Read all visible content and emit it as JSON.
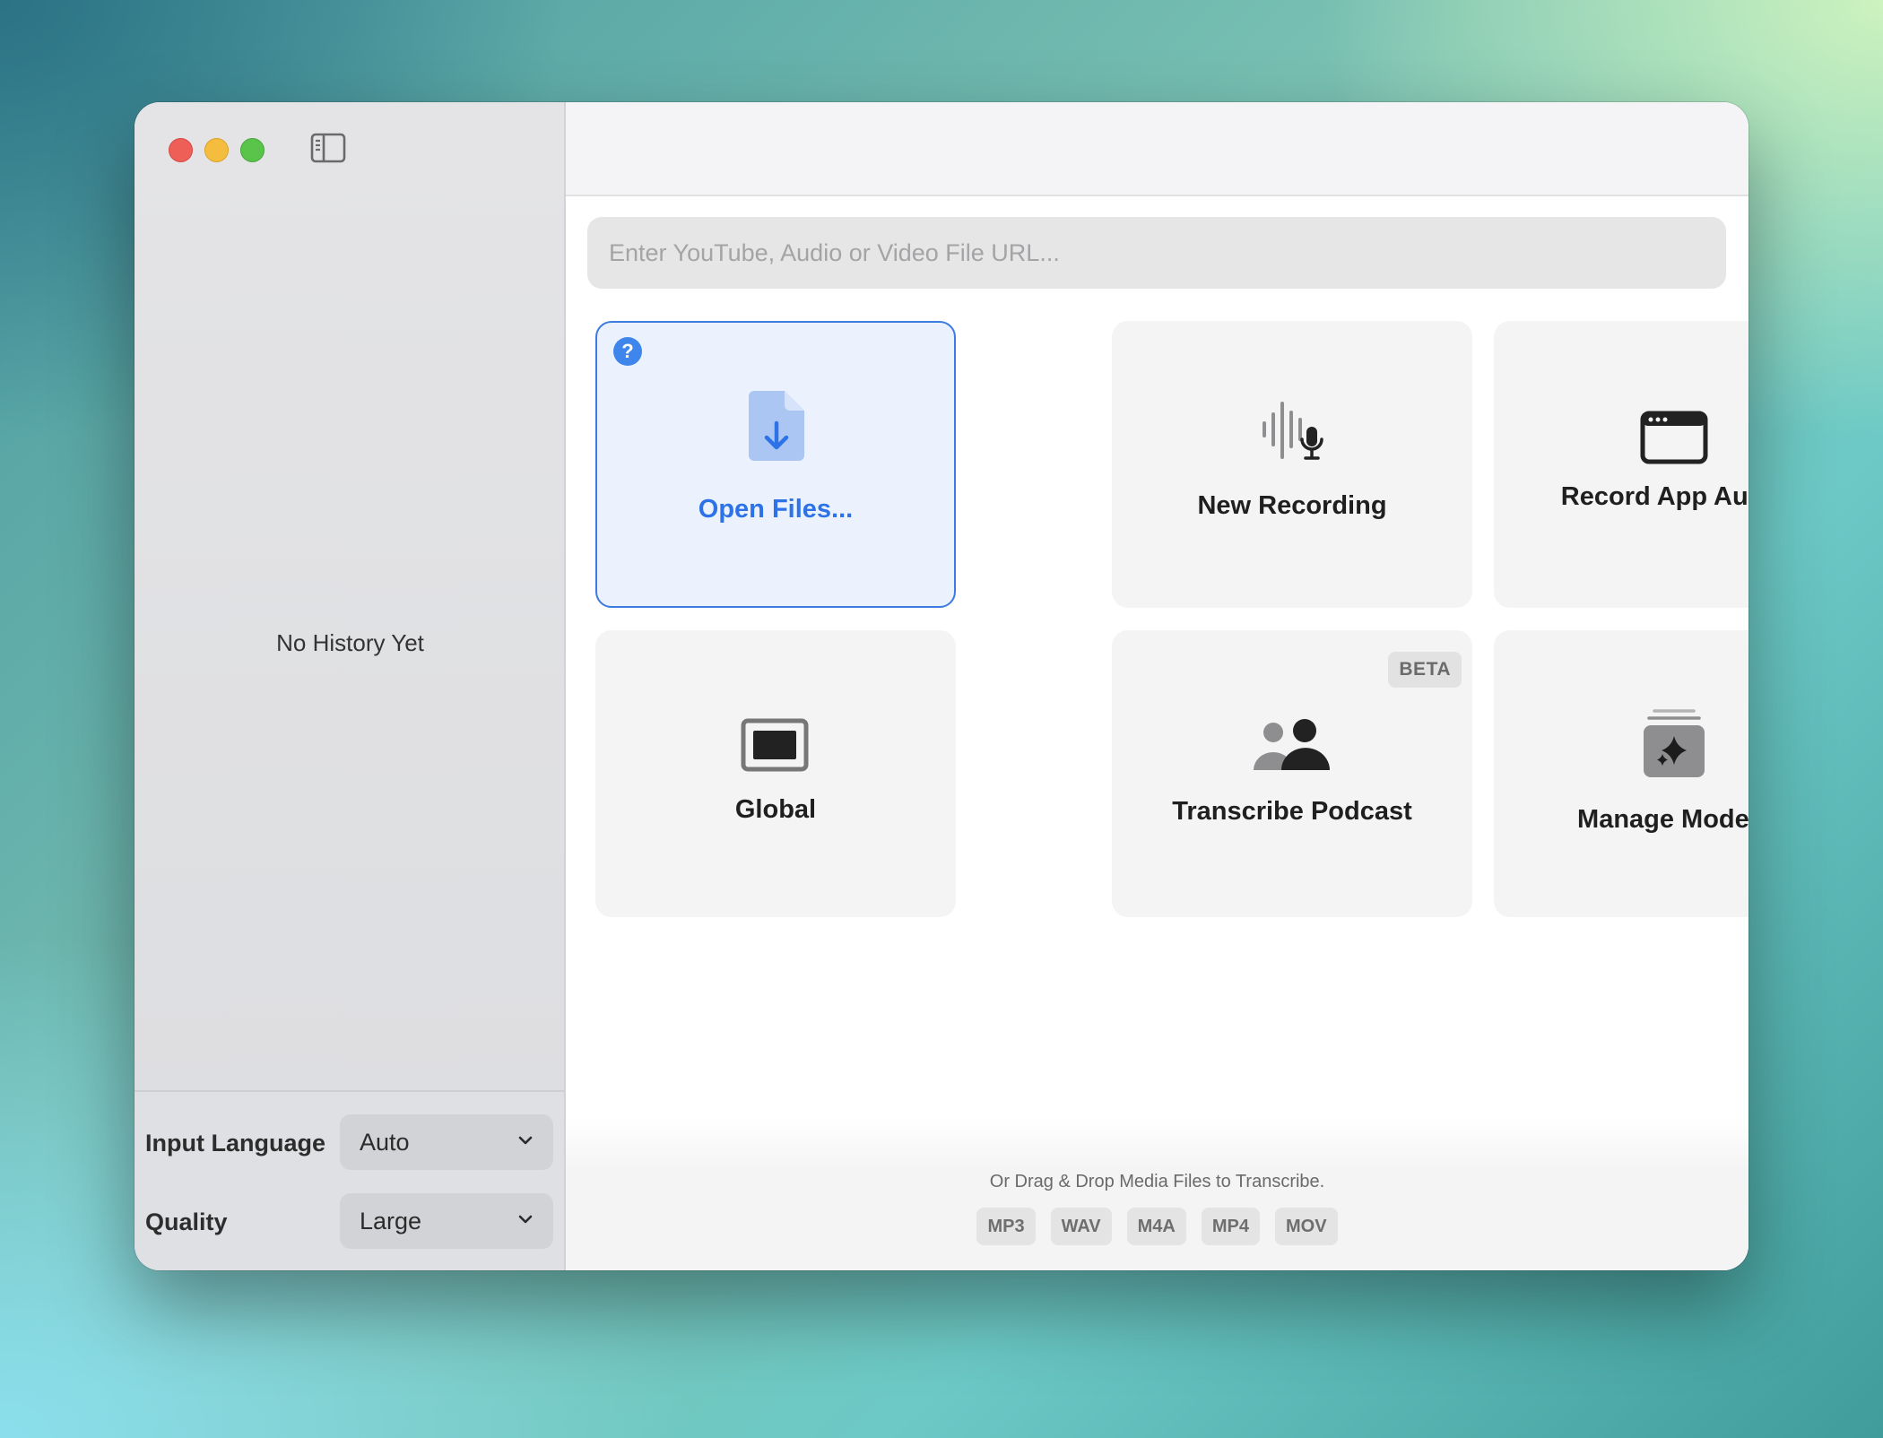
{
  "sidebar": {
    "empty_state": "No History Yet",
    "settings": {
      "input_language": {
        "label": "Input Language",
        "value": "Auto"
      },
      "quality": {
        "label": "Quality",
        "value": "Large"
      }
    }
  },
  "header": {
    "icons": [
      "book-icon",
      "gear-icon"
    ]
  },
  "url_input": {
    "placeholder": "Enter YouTube, Audio or Video File URL..."
  },
  "actions": [
    {
      "label": "Open Files...",
      "icon": "file-download-icon",
      "selected": true,
      "help_badge": "?"
    },
    {
      "label": "New Recording",
      "icon": "waveform-mic-icon"
    },
    {
      "label": "Record App Audio",
      "icon": "app-window-icon"
    },
    {
      "label": "Global",
      "icon": "display-icon"
    },
    {
      "label": "Transcribe Podcast",
      "icon": "people-icon",
      "badge": "BETA"
    },
    {
      "label": "Manage Models",
      "icon": "sparkle-stack-icon"
    }
  ],
  "footer": {
    "hint": "Or Drag & Drop Media Files to Transcribe.",
    "formats": [
      "MP3",
      "WAV",
      "M4A",
      "MP4",
      "MOV"
    ]
  },
  "colors": {
    "accent": "#3c7be0",
    "traffic_red": "#ed5f57",
    "traffic_yellow": "#f5bd3e",
    "traffic_green": "#5ac34a"
  }
}
